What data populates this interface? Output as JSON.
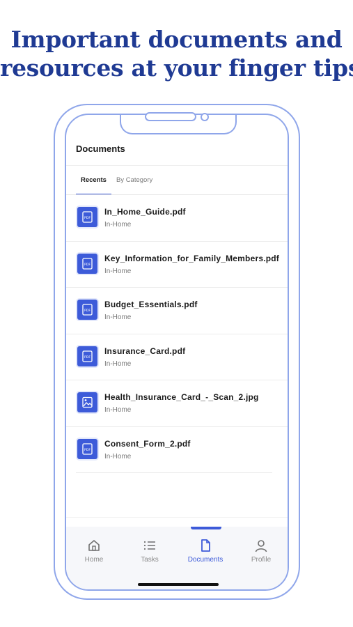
{
  "headline": {
    "line1": "Important documents and",
    "line2_part1": "resources at your",
    "line2_highlight": "finger tips"
  },
  "screen": {
    "title": "Documents",
    "tabs": [
      {
        "label": "Recents",
        "active": true
      },
      {
        "label": "By Category",
        "active": false
      }
    ],
    "documents": [
      {
        "name": "In_Home_Guide.pdf",
        "category": "In-Home",
        "icon": "pdf-file-icon"
      },
      {
        "name": "Key_Information_for_Family_Members.pdf",
        "category": "In-Home",
        "icon": "pdf-file-icon"
      },
      {
        "name": "Budget_Essentials.pdf",
        "category": "In-Home",
        "icon": "pdf-file-icon"
      },
      {
        "name": "Insurance_Card.pdf",
        "category": "In-Home",
        "icon": "pdf-file-icon"
      },
      {
        "name": "Health_Insurance_Card_-_Scan_2.jpg",
        "category": "In-Home",
        "icon": "image-file-icon"
      },
      {
        "name": "Consent_Form_2.pdf",
        "category": "In-Home",
        "icon": "pdf-file-icon"
      }
    ],
    "nav": [
      {
        "label": "Home",
        "icon": "home-icon",
        "active": false
      },
      {
        "label": "Tasks",
        "icon": "list-icon",
        "active": false
      },
      {
        "label": "Documents",
        "icon": "document-icon",
        "active": true
      },
      {
        "label": "Profile",
        "icon": "person-icon",
        "active": false
      }
    ]
  },
  "colors": {
    "headline": "#1f3a93",
    "accent": "#3d5bd9",
    "phone_outline": "#8fa6ea",
    "highlight": "#fbe6e3"
  }
}
